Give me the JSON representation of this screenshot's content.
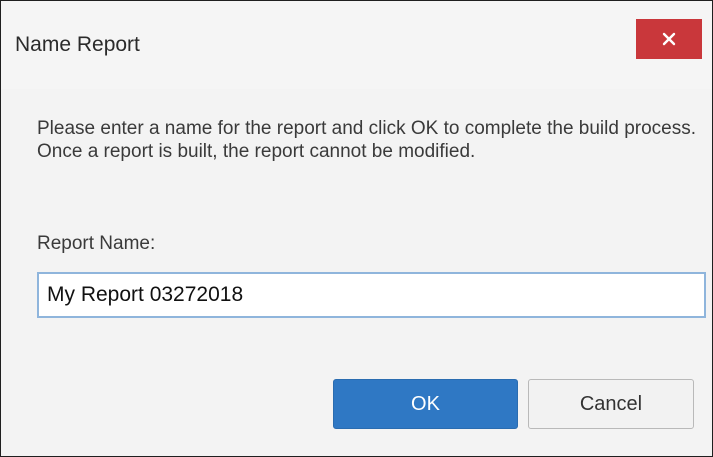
{
  "dialog": {
    "title": "Name Report",
    "close_icon": "close-icon",
    "message": "Please enter a name for the report and click OK to complete the build process. Once a report is built, the report cannot be modified.",
    "field_label": "Report Name:",
    "report_name_value": "My Report 03272018",
    "ok_label": "OK",
    "cancel_label": "Cancel"
  },
  "colors": {
    "close_button": "#c9373b",
    "ok_button": "#2f78c4",
    "input_focus_border": "#8fb5dc"
  }
}
